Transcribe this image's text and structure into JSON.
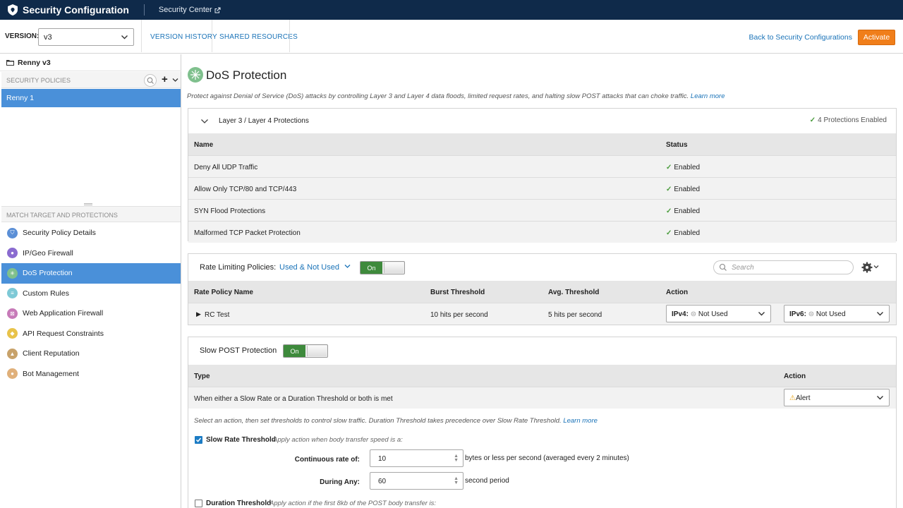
{
  "colors": {
    "topbar": "#0f2a4a",
    "accent_blue": "#4a90d9",
    "link": "#1a73b8",
    "activate": "#f07e1a",
    "toggle_on": "#3e8a3c",
    "check_green": "#4a9c3c"
  },
  "topbar": {
    "title": "Security Configuration",
    "breadcrumb": "Security Center"
  },
  "toolbar": {
    "version_label": "VERSION:",
    "version_value": "v3",
    "version_history": "VERSION HISTORY",
    "shared_resources": "SHARED RESOURCES",
    "back_link": "Back to Security Configurations",
    "activate": "Activate"
  },
  "sidebar": {
    "config_name": "Renny v3",
    "policies_header": "SECURITY POLICIES",
    "selected_policy": "Renny 1",
    "match_header": "MATCH TARGET AND PROTECTIONS",
    "nav": [
      {
        "label": "Security Policy Details",
        "icon": "shield-icon",
        "color": "#5b8fd6"
      },
      {
        "label": "IP/Geo Firewall",
        "icon": "location-pin-icon",
        "color": "#8a6bd0"
      },
      {
        "label": "DoS Protection",
        "icon": "dos-icon",
        "color": "#7fc08d",
        "active": true
      },
      {
        "label": "Custom Rules",
        "icon": "list-icon",
        "color": "#7ec9d6"
      },
      {
        "label": "Web Application Firewall",
        "icon": "firewall-icon",
        "color": "#c77ab8"
      },
      {
        "label": "API Request Constraints",
        "icon": "api-icon",
        "color": "#e8c34a"
      },
      {
        "label": "Client Reputation",
        "icon": "thumbs-up-icon",
        "color": "#c8a26a"
      },
      {
        "label": "Bot Management",
        "icon": "bot-icon",
        "color": "#e0b07a"
      }
    ]
  },
  "main": {
    "title": "DoS Protection",
    "description": "Protect against Denial of Service (DoS) attacks by controlling Layer 3 and Layer 4 data floods, limited request rates, and halting slow POST attacks that can choke traffic.",
    "learn_more": "Learn more",
    "layer34": {
      "title": "Layer 3 / Layer 4 Protections",
      "enabled_count": "4 Protections Enabled",
      "col_name": "Name",
      "col_status": "Status",
      "rows": [
        {
          "name": "Deny All UDP Traffic",
          "status": "Enabled"
        },
        {
          "name": "Allow Only TCP/80 and TCP/443",
          "status": "Enabled"
        },
        {
          "name": "SYN Flood Protections",
          "status": "Enabled"
        },
        {
          "name": "Malformed TCP Packet Protection",
          "status": "Enabled"
        }
      ]
    },
    "rate_limiting": {
      "title": "Rate Limiting Policies:",
      "filter": "Used & Not Used",
      "toggle": "On",
      "search_placeholder": "Search",
      "col_name": "Rate Policy Name",
      "col_burst": "Burst Threshold",
      "col_avg": "Avg. Threshold",
      "col_action": "Action",
      "row": {
        "name": "RC Test",
        "burst": "10 hits per second",
        "avg": "5 hits per second",
        "ipv4_label": "IPv4:",
        "ipv4_value": "Not Used",
        "ipv6_label": "IPv6:",
        "ipv6_value": "Not Used"
      }
    },
    "slow_post": {
      "title": "Slow POST Protection",
      "toggle": "On",
      "col_type": "Type",
      "col_action": "Action",
      "row_type": "When either a Slow Rate or a Duration Threshold or both is met",
      "row_action": "Alert",
      "hint": "Select an action, then set thresholds to control slow traffic. Duration Threshold takes precedence over Slow Rate Threshold.",
      "hint_link": "Learn more",
      "slow_rate_label": "Slow Rate Threshold",
      "slow_rate_desc": "Apply action when body transfer speed is a:",
      "continuous_label": "Continuous rate of:",
      "continuous_value": "10",
      "continuous_unit": "bytes or less per second (averaged every 2 minutes)",
      "during_label": "During Any:",
      "during_value": "60",
      "during_unit": "second period",
      "duration_label": "Duration Threshold",
      "duration_desc": "Apply action if the first 8kb of the POST body transfer is:"
    }
  }
}
